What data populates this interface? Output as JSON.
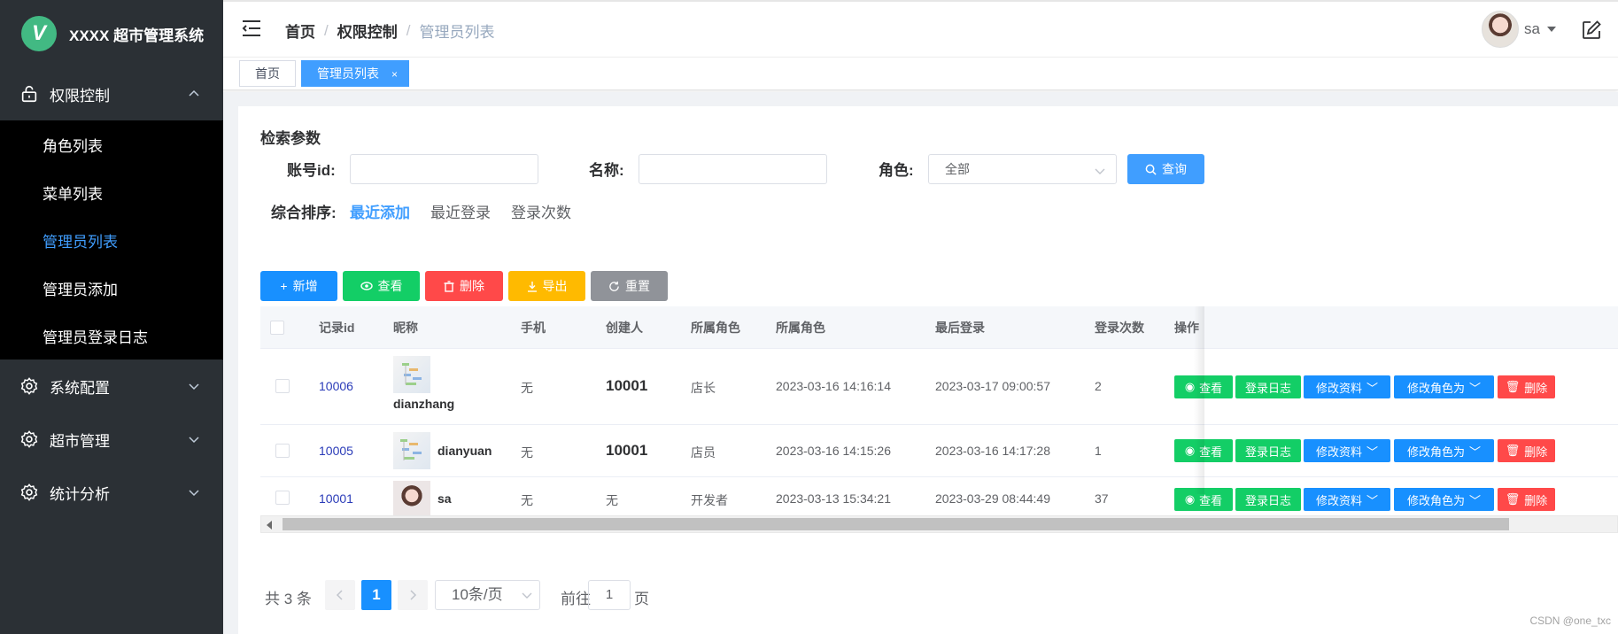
{
  "app": {
    "logo_letter": "V",
    "title": "XXXX 超市管理系统"
  },
  "sidebar": {
    "groups": [
      {
        "label": "权限控制",
        "icon": "lock-icon",
        "expanded": true,
        "items": [
          {
            "label": "角色列表"
          },
          {
            "label": "菜单列表"
          },
          {
            "label": "管理员列表",
            "active": true
          },
          {
            "label": "管理员添加"
          },
          {
            "label": "管理员登录日志"
          }
        ]
      },
      {
        "label": "系统配置",
        "icon": "gear-icon"
      },
      {
        "label": "超市管理",
        "icon": "gear-icon"
      },
      {
        "label": "统计分析",
        "icon": "gear-icon"
      }
    ]
  },
  "header": {
    "breadcrumb": [
      "首页",
      "权限控制",
      "管理员列表"
    ],
    "user": "sa"
  },
  "tags": [
    {
      "label": "首页"
    },
    {
      "label": "管理员列表",
      "active": true,
      "close": "×"
    }
  ],
  "search": {
    "title": "检索参数",
    "account_label": "账号id:",
    "name_label": "名称:",
    "role_label": "角色:",
    "role_value": "全部",
    "query_button": "查询",
    "sort_label": "综合排序:",
    "sort_options": [
      "最近添加",
      "最近登录",
      "登录次数"
    ],
    "sort_active": "最近添加"
  },
  "toolbar": {
    "add": "新增",
    "view": "查看",
    "delete": "删除",
    "export": "导出",
    "reset": "重置"
  },
  "table": {
    "columns": [
      "记录id",
      "昵称",
      "手机",
      "创建人",
      "所属角色",
      "所属角色",
      "最后登录",
      "登录次数",
      "操作"
    ],
    "rows": [
      {
        "id": "10006",
        "name": "dianzhang",
        "phone": "无",
        "creator": "10001",
        "role": "店长",
        "created": "2023-03-16 14:16:14",
        "last_login": "2023-03-17 09:00:57",
        "count": "2"
      },
      {
        "id": "10005",
        "name": "dianyuan",
        "phone": "无",
        "creator": "10001",
        "role": "店员",
        "created": "2023-03-16 14:15:26",
        "last_login": "2023-03-16 14:17:28",
        "count": "1"
      },
      {
        "id": "10001",
        "name": "sa",
        "phone": "无",
        "creator": "无",
        "role": "开发者",
        "created": "2023-03-13 15:34:21",
        "last_login": "2023-03-29 08:44:49",
        "count": "37"
      }
    ],
    "ops": {
      "view": "查看",
      "log": "登录日志",
      "edit": "修改资料",
      "role": "修改角色为",
      "delete": "删除"
    }
  },
  "pager": {
    "total": "共 3 条",
    "current": "1",
    "size": "10条/页",
    "goto_prefix": "前往",
    "goto_value": "1",
    "goto_suffix": "页"
  },
  "watermark": "CSDN @one_txc"
}
